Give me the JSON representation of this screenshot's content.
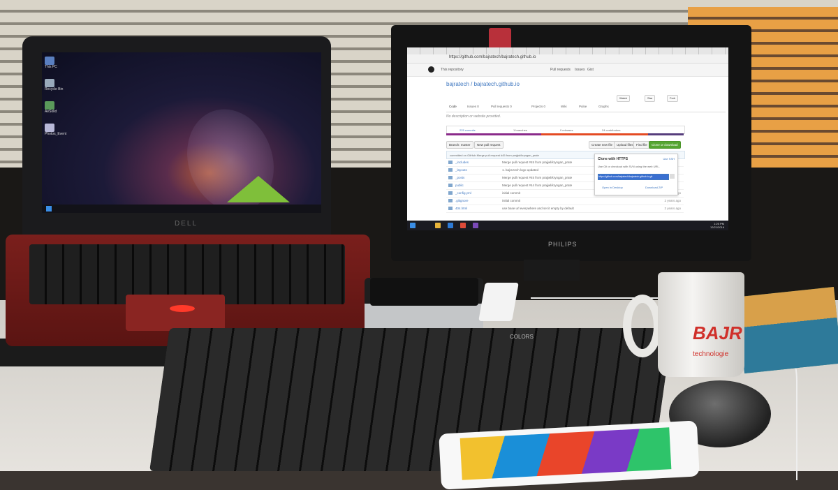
{
  "laptop": {
    "brand": "DELL",
    "desktop_icons": [
      "This PC",
      "Recycle Bin",
      "AeSolid",
      "Photos_Event"
    ]
  },
  "monitor": {
    "brand": "PHILIPS",
    "browser": {
      "url": "https://github.com/bajratech/bajratech.github.io",
      "gh_nav": [
        "This repository",
        "Pull requests",
        "Issues",
        "Gist"
      ],
      "repo_title": "bajratech / bajratech.github.io",
      "repo_actions": [
        "Watch",
        "Star",
        "Fork"
      ],
      "repo_tabs": [
        "Code",
        "Issues 0",
        "Pull requests 0",
        "Projects 0",
        "Wiki",
        "Pulse",
        "Graphs"
      ],
      "repo_description": "No description or website provided.",
      "stats": [
        "225 commits",
        "1 branches",
        "0 releases",
        "24 contributors"
      ],
      "branch_button": "Branch: master",
      "new_pr_button": "New pull request",
      "file_buttons": [
        "Create new file",
        "Upload files",
        "Find file"
      ],
      "clone_button": "Clone or download",
      "commit_message": "committed on GitHub  Merge pull request #45 from prajjwl/kryngan_prate",
      "files": [
        {
          "name": "_includes",
          "msg": "Merge pull request #45 from prajjwl/kryngan_prate"
        },
        {
          "name": "_layouts",
          "msg": "1. bajra tech logo updated"
        },
        {
          "name": "_posts",
          "msg": "Merge pull request #45 from prajjwl/kryngan_prate"
        },
        {
          "name": "public",
          "msg": "Merge pull request #44 from prajjwl/kryngan_prate"
        },
        {
          "name": "_config.yml",
          "msg": "initial commit",
          "age": "11 days ago"
        },
        {
          "name": ".gitignore",
          "msg": "initial commit",
          "age": "2 years ago"
        },
        {
          "name": "404.html",
          "msg": "use base url everywhere and set it empty by default",
          "age": "2 years ago"
        }
      ],
      "clone_popover": {
        "title": "Clone with HTTPS",
        "use_ssh": "Use SSH",
        "hint": "Use Git or checkout with SVN using the web URL.",
        "url": "https://github.com/bajratech/bajratech.github.io.git",
        "open_desktop": "Open in Desktop",
        "download_zip": "Download ZIP"
      }
    },
    "clock_time": "1:25 PM",
    "clock_date": "12/21/2016"
  },
  "keyboard_brand": "COLORS",
  "mug": {
    "logo": "BAJR",
    "tagline": "technologie"
  },
  "colors": {
    "github_link": "#4078c0",
    "github_green": "#55a532",
    "laptop_red": "#7a1f1c"
  }
}
